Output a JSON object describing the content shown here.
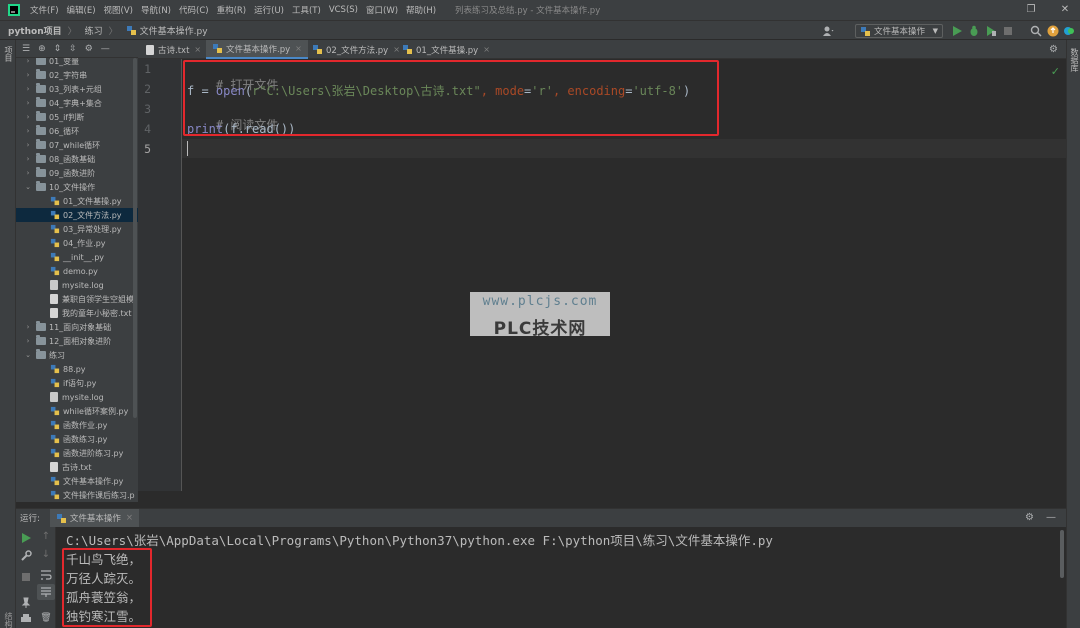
{
  "menubar": {
    "items": [
      "文件(F)",
      "编辑(E)",
      "视图(V)",
      "导航(N)",
      "代码(C)",
      "重构(R)",
      "运行(U)",
      "工具(T)",
      "VCS(S)",
      "窗口(W)",
      "帮助(H)"
    ],
    "window_title": "列表练习及总结.py - 文件基本操作.py"
  },
  "navbar": {
    "crumbs": [
      "python项目",
      "练习",
      "文件基本操作.py"
    ],
    "run_config": "文件基本操作"
  },
  "left_strip": {
    "project_label": "项目",
    "structure_label": "结构",
    "favorites_label": "收藏夹"
  },
  "project_tree": [
    {
      "label": "01_变量",
      "kind": "folder",
      "depth": 0,
      "open": false
    },
    {
      "label": "02_字符串",
      "kind": "folder",
      "depth": 0,
      "open": false
    },
    {
      "label": "03_列表+元组",
      "kind": "folder",
      "depth": 0,
      "open": false
    },
    {
      "label": "04_字典+集合",
      "kind": "folder",
      "depth": 0,
      "open": false
    },
    {
      "label": "05_if判断",
      "kind": "folder",
      "depth": 0,
      "open": false
    },
    {
      "label": "06_循环",
      "kind": "folder",
      "depth": 0,
      "open": false
    },
    {
      "label": "07_while循环",
      "kind": "folder",
      "depth": 0,
      "open": false
    },
    {
      "label": "08_函数基础",
      "kind": "folder",
      "depth": 0,
      "open": false
    },
    {
      "label": "09_函数进阶",
      "kind": "folder",
      "depth": 0,
      "open": false
    },
    {
      "label": "10_文件操作",
      "kind": "folder",
      "depth": 0,
      "open": true
    },
    {
      "label": "01_文件基操.py",
      "kind": "py",
      "depth": 1
    },
    {
      "label": "02_文件方法.py",
      "kind": "py",
      "depth": 1,
      "selected": true
    },
    {
      "label": "03_异常处理.py",
      "kind": "py",
      "depth": 1
    },
    {
      "label": "04_作业.py",
      "kind": "py",
      "depth": 1
    },
    {
      "label": "__init__.py",
      "kind": "py",
      "depth": 1
    },
    {
      "label": "demo.py",
      "kind": "py",
      "depth": 1
    },
    {
      "label": "mysite.log",
      "kind": "log",
      "depth": 1
    },
    {
      "label": "兼职自领学生空姐模",
      "kind": "txt",
      "depth": 1
    },
    {
      "label": "我的童年小秘密.txt",
      "kind": "txt",
      "depth": 1
    },
    {
      "label": "11_面向对象基础",
      "kind": "folder",
      "depth": 0,
      "open": false
    },
    {
      "label": "12_面相对象进阶",
      "kind": "folder",
      "depth": 0,
      "open": false
    },
    {
      "label": "练习",
      "kind": "folder",
      "depth": 0,
      "open": true
    },
    {
      "label": "88.py",
      "kind": "py",
      "depth": 1
    },
    {
      "label": "if语句.py",
      "kind": "py",
      "depth": 1
    },
    {
      "label": "mysite.log",
      "kind": "log",
      "depth": 1
    },
    {
      "label": "while循环案例.py",
      "kind": "py",
      "depth": 1
    },
    {
      "label": "函数作业.py",
      "kind": "py",
      "depth": 1
    },
    {
      "label": "函数练习.py",
      "kind": "py",
      "depth": 1
    },
    {
      "label": "函数进阶练习.py",
      "kind": "py",
      "depth": 1
    },
    {
      "label": "古诗.txt",
      "kind": "txt",
      "depth": 1
    },
    {
      "label": "文件基本操作.py",
      "kind": "py",
      "depth": 1
    },
    {
      "label": "文件操作课后练习.p",
      "kind": "py",
      "depth": 1
    }
  ],
  "tabs": [
    {
      "label": "古诗.txt",
      "kind": "txt",
      "active": false
    },
    {
      "label": "文件基本操作.py",
      "kind": "py",
      "active": true
    },
    {
      "label": "02_文件方法.py",
      "kind": "py",
      "active": false
    },
    {
      "label": "01_文件基操.py",
      "kind": "py",
      "active": false
    }
  ],
  "editor": {
    "line_numbers": [
      "1",
      "2",
      "3",
      "4",
      "5"
    ],
    "line1_comment": "# 打开文件",
    "line2": {
      "var": "f",
      "op": " = ",
      "fn": "open",
      "paren_open": "(",
      "path": "r\"C:\\Users\\张岩\\Desktop\\古诗.txt\"",
      "comma1": ", ",
      "kw1": "mode",
      "eq1": "=",
      "val1": "'r'",
      "comma2": ", ",
      "kw2": "encoding",
      "eq2": "=",
      "val2": "'utf-8'",
      "paren_close": ")"
    },
    "line3_comment": "# 阅读文件",
    "line4": {
      "fn": "print",
      "rest": "(f.read())"
    }
  },
  "watermark": {
    "url": "www.plcjs.com",
    "name": "PLC技术网"
  },
  "run_panel": {
    "label": "运行:",
    "tab_label": "文件基本操作",
    "command": "C:\\Users\\张岩\\AppData\\Local\\Programs\\Python\\Python37\\python.exe F:\\python项目\\练习\\文件基本操作.py",
    "output": [
      "千山鸟飞绝，",
      "万径人踪灭。",
      "孤舟蓑笠翁，",
      "独钓寒江雪。"
    ]
  },
  "colors": {
    "accent_red": "#e3282d",
    "run_green": "#499c54",
    "selection": "#0d293e"
  }
}
